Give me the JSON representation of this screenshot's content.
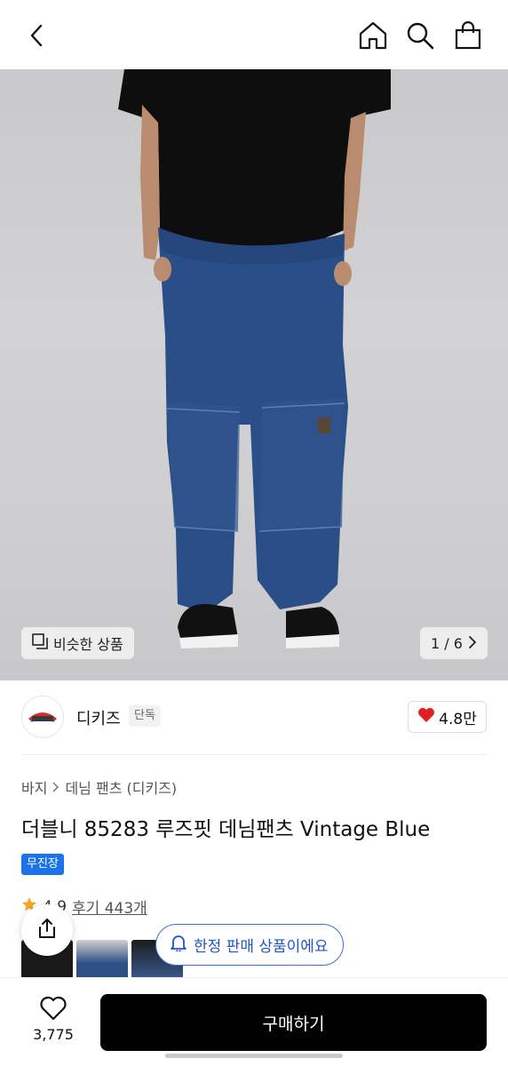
{
  "header": {
    "icons": [
      "back-arrow-icon",
      "home-icon",
      "search-icon",
      "shopping-bag-icon"
    ]
  },
  "hero": {
    "similar_label": "비슷한 상품",
    "pager": "1 / 6"
  },
  "brand": {
    "name": "디키즈",
    "tag": "단독",
    "likes": "4.8만"
  },
  "product": {
    "breadcrumb_category": "바지",
    "breadcrumb_subcategory": "데님 팬츠 (디키즈)",
    "title": "더블니 85283 루즈핏 데님팬츠 Vintage Blue",
    "badge": "무진장",
    "rating": "4.9",
    "reviews": "후기 443개"
  },
  "notice": {
    "text": "한정 판매 상품이에요"
  },
  "bottom": {
    "wish_count": "3,775",
    "buy_label": "구매하기"
  },
  "colors": {
    "accent_blue": "#1a73e8",
    "notice_blue": "#2255c4",
    "heart_red": "#e02020",
    "star_orange": "#f5a623"
  }
}
